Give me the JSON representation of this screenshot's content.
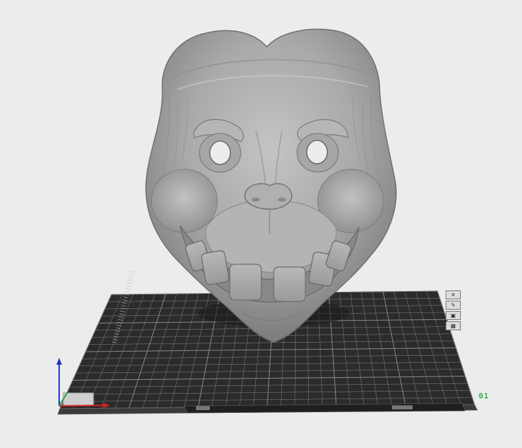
{
  "viewport": {
    "background_color": "#ececec",
    "model_color": "#9c9c9c",
    "bed_color": "#2a2a2a",
    "grid_color": "#8a8a8a",
    "plate_label": "01",
    "plate_label_color": "#2bb24c",
    "axes": {
      "x_color": "#d02020",
      "y_color": "#20a040",
      "z_color": "#2030c0"
    }
  },
  "view_toolbar": {
    "buttons": [
      {
        "icon": "close-icon",
        "glyph": "✕"
      },
      {
        "icon": "edit-icon",
        "glyph": "✎"
      },
      {
        "icon": "camera-icon",
        "glyph": "▣"
      },
      {
        "icon": "grid-icon",
        "glyph": "▦"
      }
    ]
  }
}
